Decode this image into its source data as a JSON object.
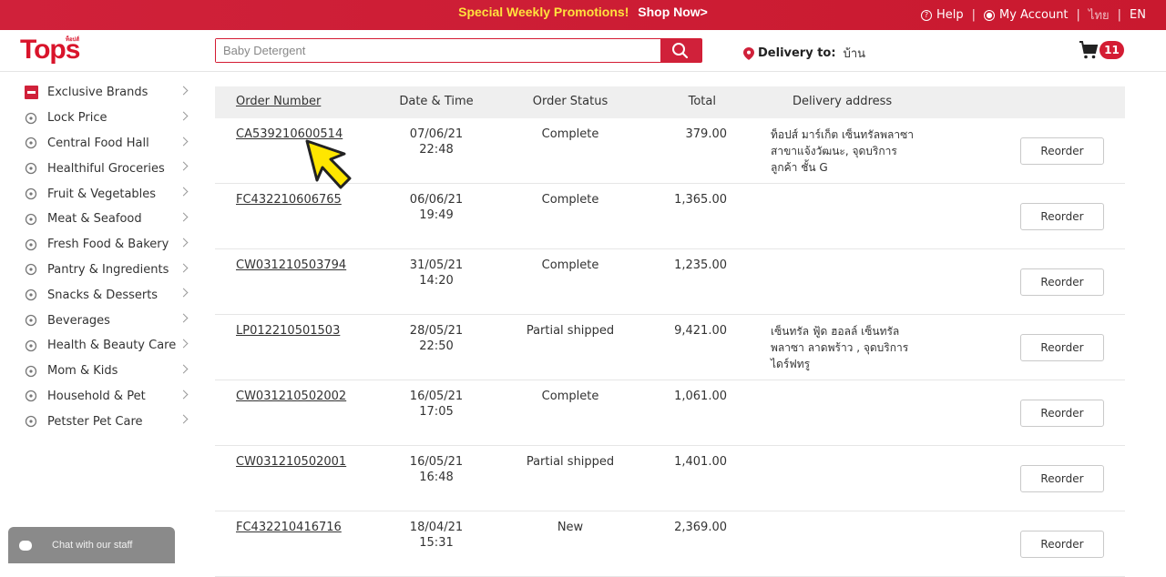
{
  "promo": {
    "text": "Special Weekly Promotions!",
    "link": "Shop Now>"
  },
  "toplinks": {
    "help": "Help",
    "account": "My Account",
    "lang_th": "ไทย",
    "lang_en": "EN"
  },
  "logo": {
    "text": "Tops",
    "small": "ท็อปส์"
  },
  "search": {
    "placeholder": "Baby Detergent"
  },
  "delivery": {
    "label": "Delivery to:",
    "value": "บ้าน"
  },
  "cart": {
    "count": "11"
  },
  "sidebar": [
    {
      "label": "Exclusive Brands",
      "icon": "tops-logo-icon"
    },
    {
      "label": "Lock Price",
      "icon": "tag-icon"
    },
    {
      "label": "Central Food Hall",
      "icon": "market-icon"
    },
    {
      "label": "Healthiful Groceries",
      "icon": "leaf-icon"
    },
    {
      "label": "Fruit & Vegetables",
      "icon": "apple-icon"
    },
    {
      "label": "Meat & Seafood",
      "icon": "meat-icon"
    },
    {
      "label": "Fresh Food & Bakery",
      "icon": "bakery-icon"
    },
    {
      "label": "Pantry & Ingredients",
      "icon": "jar-icon"
    },
    {
      "label": "Snacks & Desserts",
      "icon": "snack-icon"
    },
    {
      "label": "Beverages",
      "icon": "bottle-icon"
    },
    {
      "label": "Health & Beauty Care",
      "icon": "eye-icon"
    },
    {
      "label": "Mom & Kids",
      "icon": "baby-icon"
    },
    {
      "label": "Household & Pet",
      "icon": "spray-icon"
    },
    {
      "label": "Petster Pet Care",
      "icon": "pet-icon"
    }
  ],
  "table": {
    "headers": {
      "number": "Order Number",
      "date": "Date & Time",
      "status": "Order Status",
      "total": "Total",
      "address": "Delivery address"
    },
    "reorder_label": "Reorder",
    "rows": [
      {
        "number": "CA539210600514",
        "date": "07/06/21",
        "time": "22:48",
        "status": "Complete",
        "total": "379.00",
        "address": "ท็อปส์ มาร์เก็ต เซ็นทรัลพลาซา สาขาแจ้งวัฒนะ, จุดบริการ ลูกค้า ชั้น G",
        "faded": false
      },
      {
        "number": "FC432210606765",
        "date": "06/06/21",
        "time": "19:49",
        "status": "Complete",
        "total": "1,365.00",
        "address": "",
        "faded": true
      },
      {
        "number": "CW031210503794",
        "date": "31/05/21",
        "time": "14:20",
        "status": "Complete",
        "total": "1,235.00",
        "address": "",
        "faded": true
      },
      {
        "number": "LP012210501503",
        "date": "28/05/21",
        "time": "22:50",
        "status": "Partial shipped",
        "total": "9,421.00",
        "address": "เซ็นทรัล ฟู้ด ฮอลล์ เซ็นทรัล พลาซา ลาดพร้าว , จุดบริการ ไดร์ฟทรู",
        "faded": false
      },
      {
        "number": "CW031210502002",
        "date": "16/05/21",
        "time": "17:05",
        "status": "Complete",
        "total": "1,061.00",
        "address": "",
        "faded": true
      },
      {
        "number": "CW031210502001",
        "date": "16/05/21",
        "time": "16:48",
        "status": "Partial shipped",
        "total": "1,401.00",
        "address": "",
        "faded": true
      },
      {
        "number": "FC432210416716",
        "date": "18/04/21",
        "time": "15:31",
        "status": "New",
        "total": "2,369.00",
        "address": "",
        "faded": true
      }
    ]
  },
  "chat": {
    "label": "Chat with our staff"
  },
  "colors": {
    "brand": "#d0213a",
    "promo_highlight": "#ffe23d"
  }
}
